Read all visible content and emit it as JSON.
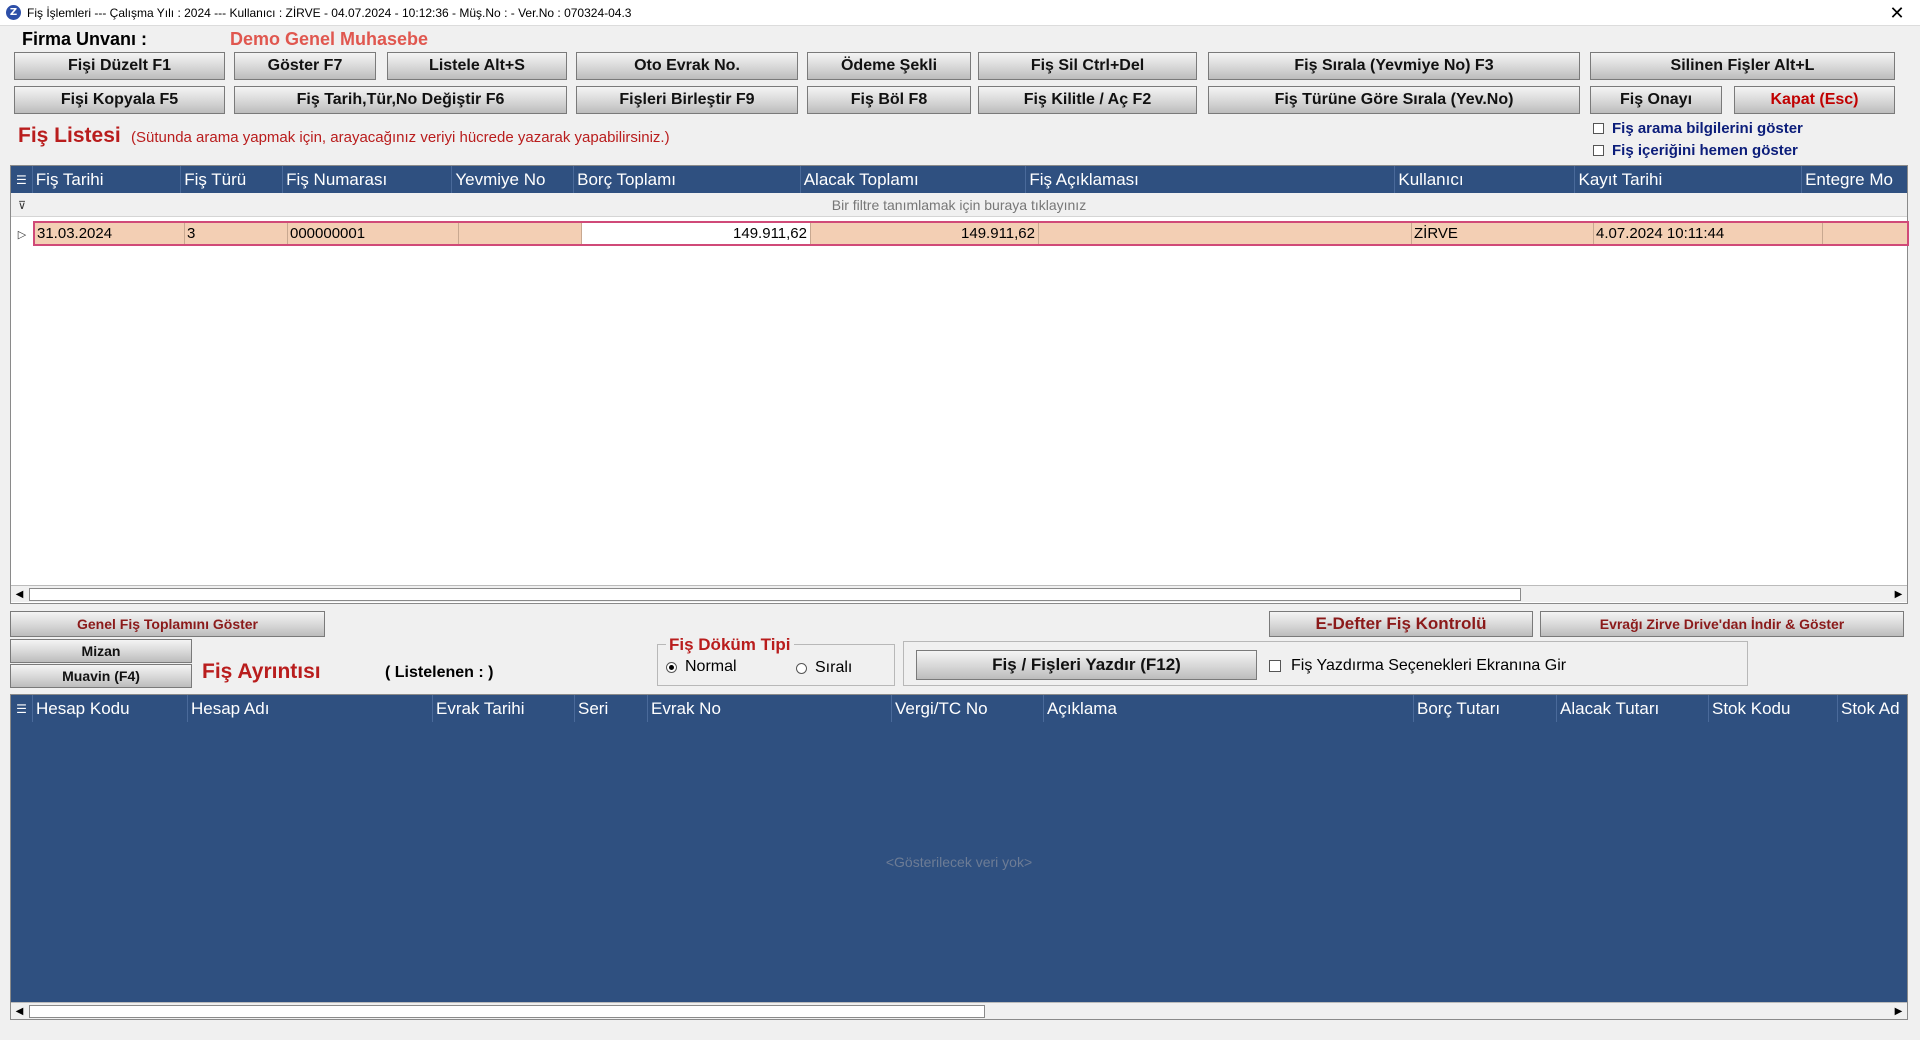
{
  "window": {
    "title": "Fiş İşlemleri  ---  Çalışma Yılı : 2024  ---  Kullanıcı : ZİRVE - 04.07.2024 - 10:12:36 - Müş.No :  - Ver.No : 070324-04.3",
    "app_icon": "Z",
    "close_glyph": "✕"
  },
  "firma": {
    "label": "Firma  Unvanı :",
    "value": "Demo Genel Muhasebe"
  },
  "toolbar": {
    "row1": [
      "Fişi Düzelt F1",
      "Göster F7",
      "Listele Alt+S",
      "Oto Evrak No.",
      "Ödeme Şekli",
      "Fiş Sil Ctrl+Del",
      "Fiş Sırala (Yevmiye No) F3",
      "Silinen Fişler Alt+L"
    ],
    "row2": [
      "Fişi Kopyala F5",
      "Fiş Tarih,Tür,No Değiştir F6",
      "Fişleri Birleştir F9",
      "Fiş Böl F8",
      "Fiş Kilitle / Aç F2",
      "Fiş Türüne Göre Sırala (Yev.No)",
      "Fiş Onayı",
      "Kapat (Esc)"
    ]
  },
  "fis_listesi": {
    "title": "Fiş Listesi",
    "hint": "(Sütunda arama yapmak için, arayacağınız veriyi hücrede yazarak yapabilirsiniz.)",
    "checkbox1": "Fiş arama bilgilerini göster",
    "checkbox2": "Fiş içeriğini hemen göster",
    "columns": [
      "Fiş Tarihi",
      "Fiş Türü",
      "Fiş Numarası",
      "Yevmiye No",
      "Borç Toplamı",
      "Alacak Toplamı",
      "Fiş Açıklaması",
      "Kullanıcı",
      "Kayıt Tarihi",
      "Entegre Mo"
    ],
    "filter_text": "Bir filtre tanımlamak için buraya tıklayınız",
    "rows": [
      [
        "31.03.2024",
        "3",
        "000000001",
        "",
        "149.911,62",
        "149.911,62",
        "",
        "ZİRVE",
        "4.07.2024 10:11:44",
        ""
      ]
    ]
  },
  "middle": {
    "genel_toplam_btn": "Genel Fiş Toplamını Göster",
    "mizan_btn": "Mizan",
    "muavin_btn": "Muavin (F4)",
    "fis_ayrintisi_title": "Fiş Ayrıntısı",
    "listelenen": "( Listelenen : )",
    "dokum_title": "Fiş Döküm Tipi",
    "radio_normal": "Normal",
    "radio_sirali": "Sıralı",
    "yazdir_btn": "Fiş / Fişleri Yazdır (F12)",
    "yazdir_chk": "Fiş Yazdırma Seçenekleri Ekranına Gir",
    "edefter_btn": "E-Defter Fiş Kontrolü",
    "drive_btn": "Evrağı Zirve Drive'dan İndir & Göster"
  },
  "detail": {
    "columns": [
      "Hesap Kodu",
      "Hesap Adı",
      "Evrak Tarihi",
      "Seri",
      "Evrak No",
      "Vergi/TC No",
      "Açıklama",
      "Borç Tutarı",
      "Alacak Tutarı",
      "Stok Kodu",
      "Stok Ad"
    ],
    "empty_text": "<Gösterilecek veri yok>"
  },
  "icons": {
    "filter": "filter-icon",
    "grid_menu": "grid-menu-icon",
    "row_indicator": "row-indicator-icon",
    "scroll_left": "◀",
    "scroll_right": "▶"
  },
  "colors": {
    "header_bg": "#2f5080",
    "selected_row": "#f3cfb4",
    "title_red": "#b91d1d",
    "firma_red": "#e0574f"
  }
}
